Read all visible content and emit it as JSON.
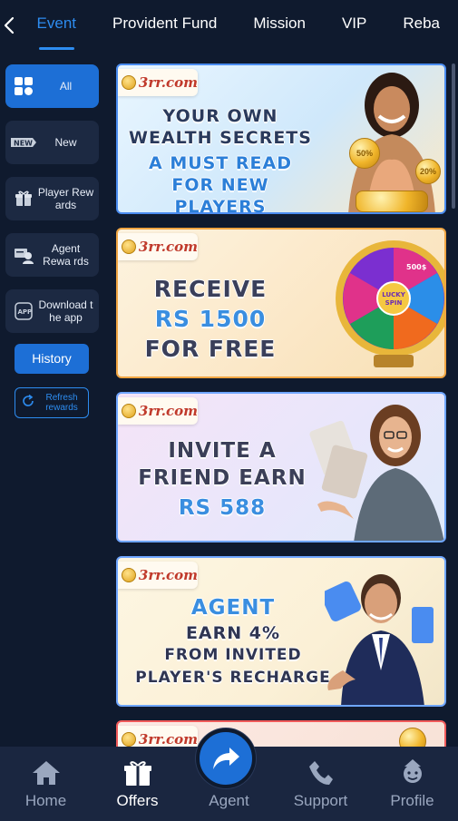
{
  "topnav": {
    "back_icon": "chevron-left-icon",
    "tabs": [
      {
        "label": "Event",
        "active": true
      },
      {
        "label": "Provident Fund",
        "active": false
      },
      {
        "label": "Mission",
        "active": false
      },
      {
        "label": "VIP",
        "active": false
      },
      {
        "label": "Reba",
        "active": false
      }
    ]
  },
  "sidebar": {
    "items": [
      {
        "label": "All",
        "icon": "grid-icon",
        "active": true
      },
      {
        "label": "New",
        "icon": "new-badge-icon",
        "active": false
      },
      {
        "label": "Player Rew ards",
        "icon": "gift-icon",
        "active": false
      },
      {
        "label": "Agent Rewa rds",
        "icon": "agent-icon",
        "active": false
      },
      {
        "label": "Download t he app",
        "icon": "app-icon",
        "active": false
      }
    ],
    "history_label": "History",
    "refresh_label": "Refresh rewards"
  },
  "banners": [
    {
      "logo": "3rr.com",
      "lines": [
        "YOUR OWN",
        "WEALTH SECRETS",
        "A MUST READ",
        "FOR NEW PLAYERS"
      ],
      "coin_labels": [
        "50%",
        "20%"
      ]
    },
    {
      "logo": "3rr.com",
      "lines": [
        "RECEIVE",
        "RS 1500",
        "FOR FREE"
      ],
      "wheel_center": "LUCKY SPIN",
      "wheel_label": "500$"
    },
    {
      "logo": "3rr.com",
      "lines": [
        "INVITE A",
        "FRIEND EARN",
        "RS 588"
      ]
    },
    {
      "logo": "3rr.com",
      "lines": [
        "AGENT",
        "EARN 4%",
        "FROM INVITED",
        "PLAYER'S RECHARGE"
      ]
    },
    {
      "logo": "3rr.com"
    }
  ],
  "bottomnav": {
    "items": [
      {
        "label": "Home",
        "icon": "home-icon",
        "active": false
      },
      {
        "label": "Offers",
        "icon": "gift-icon",
        "active": true
      },
      {
        "label": "Agent",
        "icon": "share-arrow-icon",
        "active": false
      },
      {
        "label": "Support",
        "icon": "phone-icon",
        "active": false
      },
      {
        "label": "Profile",
        "icon": "profile-icon",
        "active": false
      }
    ]
  },
  "colors": {
    "background": "#0f1a2e",
    "accent": "#2d8cf0",
    "active_bg": "#1d6fd6",
    "panel": "#1c2942"
  }
}
